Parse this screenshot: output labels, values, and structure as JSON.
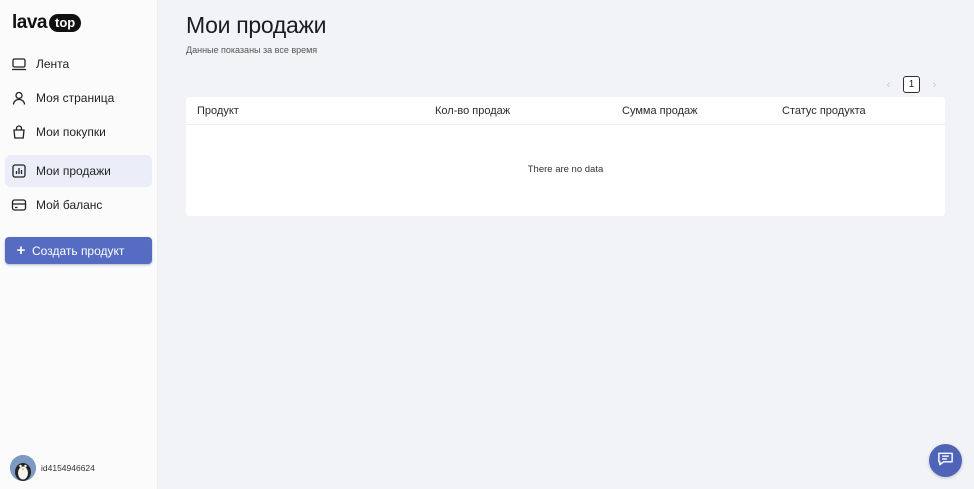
{
  "logo": {
    "part1": "lava",
    "part2": "top"
  },
  "sidebar": {
    "items": [
      {
        "label": "Лента",
        "icon": "feed-icon"
      },
      {
        "label": "Моя страница",
        "icon": "user-icon"
      },
      {
        "label": "Мои покупки",
        "icon": "shopping-bag-icon"
      },
      {
        "label": "Мои продажи",
        "icon": "bar-chart-icon",
        "active": true
      },
      {
        "label": "Мой баланс",
        "icon": "wallet-icon"
      }
    ],
    "create_button": {
      "icon": "plus-icon",
      "label": "Создать продукт"
    },
    "user": {
      "id": "id4154946624"
    }
  },
  "main": {
    "title": "Мои продажи",
    "subtitle": "Данные показаны за все время",
    "pagination": {
      "current_page": "1",
      "prev_icon": "chevron-left-icon",
      "next_icon": "chevron-right-icon"
    },
    "table": {
      "columns": [
        "Продукт",
        "Кол-во продаж",
        "Сумма продаж",
        "Статус продукта"
      ],
      "rows": [],
      "empty_text": "There are no data"
    }
  },
  "chat": {
    "icon": "chat-icon"
  },
  "colors": {
    "accent": "#566bc2",
    "active_nav_bg": "#ebedf8",
    "page_bg": "#f2f3f6"
  }
}
